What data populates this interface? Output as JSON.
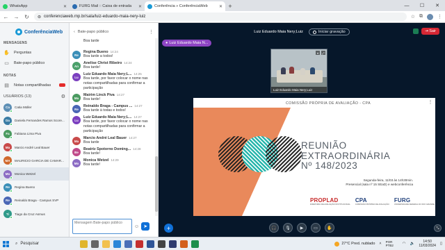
{
  "browser": {
    "tabs": [
      {
        "label": "WhatsApp",
        "color": "#25d366",
        "active": false
      },
      {
        "label": "FURG Mail :: Caixa de entrada",
        "color": "#2b6cb0",
        "active": false
      },
      {
        "label": "Conferência » ConferênciaWeb",
        "color": "#1a9ad6",
        "active": true
      }
    ],
    "url": "conferenciaweb.rnp.br/sala/luiz-eduardo-maia-nery-luiz",
    "new_tab": "+"
  },
  "sidebar": {
    "logo": "ConferênciaWeb",
    "messages_title": "MENSAGENS",
    "items": [
      {
        "label": "Perguntas",
        "icon": "hand-icon"
      },
      {
        "label": "Bate-papo público",
        "icon": "chat-icon"
      }
    ],
    "notes_title": "NOTAS",
    "notes_item": "Notas compartilhadas",
    "users_title": "USUÁRIOS (13)",
    "users": [
      {
        "initials": "Ca",
        "name": "Catia Müller",
        "color": "#5d8fb5"
      },
      {
        "initials": "Da",
        "name": "Daniela Fernandes Ramos Score...",
        "color": "#3a7ca5"
      },
      {
        "initials": "Fa",
        "name": "Fabiana Lima Piva",
        "color": "#4b9a60"
      },
      {
        "initials": "Ma",
        "name": "Marcio André Leal Bauer",
        "color": "#c94a4a"
      },
      {
        "initials": "MA",
        "name": "MAURICIO GARCIA DE CAMAR...",
        "color": "#d0692e"
      },
      {
        "initials": "Mo",
        "name": "Monica Wetzel",
        "color": "#8c6cc4"
      },
      {
        "initials": "Re",
        "name": "Regina Bueno",
        "color": "#3b8fb8"
      },
      {
        "initials": "Re",
        "name": "Reinaldo Braga - Campus SVP",
        "color": "#4a66b5"
      },
      {
        "initials": "Ti",
        "name": "Tiago da Cruz Asmus",
        "color": "#2f9a8a"
      }
    ]
  },
  "chat": {
    "title": "Bate-papo público",
    "messages": [
      {
        "initials": "",
        "name": "",
        "time": "",
        "text": "Boa tarde",
        "color": "#000000"
      },
      {
        "initials": "Re",
        "name": "Regina Bueno",
        "time": "14:24",
        "text": "Boa tarde a todos!",
        "color": "#3b8fb8"
      },
      {
        "initials": "An",
        "name": "Anelise Christ Ribeiro",
        "time": "14:24",
        "text": "Boa tarde!",
        "color": "#4ba06a"
      },
      {
        "initials": "Lu",
        "name": "Luiz Eduardo Maia Nery;L...",
        "time": "14:25",
        "text": "Boa tarde, por favor colocar o nome nas notas compartilhadas para confirmar a participação",
        "color": "#7b3fbf"
      },
      {
        "initials": "Ma",
        "name": "Mairim Linck Piva",
        "time": "14:27",
        "text": "Boa tarde!",
        "color": "#4b9a60"
      },
      {
        "initials": "Re",
        "name": "Reinaldo Braga - Campus ...",
        "time": "14:27",
        "text": "Boa tarde à todas e todos!",
        "color": "#4a66b5"
      },
      {
        "initials": "Lu",
        "name": "Luiz Eduardo Maia Nery;L...",
        "time": "14:27",
        "text": "Boa tarde, por favor colocar o nome nas notas compartilhadas para confirmar a participação",
        "color": "#7b3fbf"
      },
      {
        "initials": "Ma",
        "name": "Marcio André Leal Bauer",
        "time": "14:27",
        "text": "Boa tarde",
        "color": "#c94a4a"
      },
      {
        "initials": "Be",
        "name": "Beatriz Spotorno Doming...",
        "time": "14:28",
        "text": "Boa tarde!",
        "color": "#c04a8a"
      },
      {
        "initials": "Mo",
        "name": "Monica Wetzel",
        "time": "14:29",
        "text": "Boa tarde!",
        "color": "#8c6cc4"
      }
    ],
    "input_placeholder": "Mensagem Bate-papo público"
  },
  "stage": {
    "meeting_title": "Luiz Eduardo Maia Nery;Luiz",
    "record_label": "Iniciar gravação",
    "exit_label": "Sair",
    "presenter_tag": "Luiz Eduardo Maia N...",
    "video_label": "Luiz Eduardo Maia Nery;Luiz",
    "slide": {
      "header": "COMISSÃO PRÓPRIA DE AVALIAÇÃO - CPA",
      "title_lines": [
        "REUNIÃO",
        "EXTRAORDINÁRIA",
        "Nº 148/2023"
      ],
      "date_lines": [
        "Segunda-feira, 11/03 às 14h30min.",
        "Presencial (sala nº 15 SEaD) e webconferência"
      ],
      "logos": [
        {
          "name": "PROPLAD",
          "sub": "DIRETORIA DE AVALIAÇÃO INSTITUCIONAL",
          "color": "#c62828"
        },
        {
          "name": "CPA",
          "sub": "COMISSÃO PRÓPRIA DE AVALIAÇÃO",
          "color": "#1f3f7a"
        },
        {
          "name": "FURG",
          "sub": "UNIVERSIDADE FEDERAL DO RIO GRANDE",
          "color": "#1f3f7a"
        }
      ],
      "colors": {
        "orange": "#e9895b",
        "teal": "#21b3a9",
        "dark": "#222222"
      }
    }
  },
  "taskbar": {
    "search_label": "Pesquisar",
    "weather": "27°C  Pred. nublado",
    "lang": "POR PTB2",
    "time": "14:50",
    "date": "11/03/2024"
  }
}
